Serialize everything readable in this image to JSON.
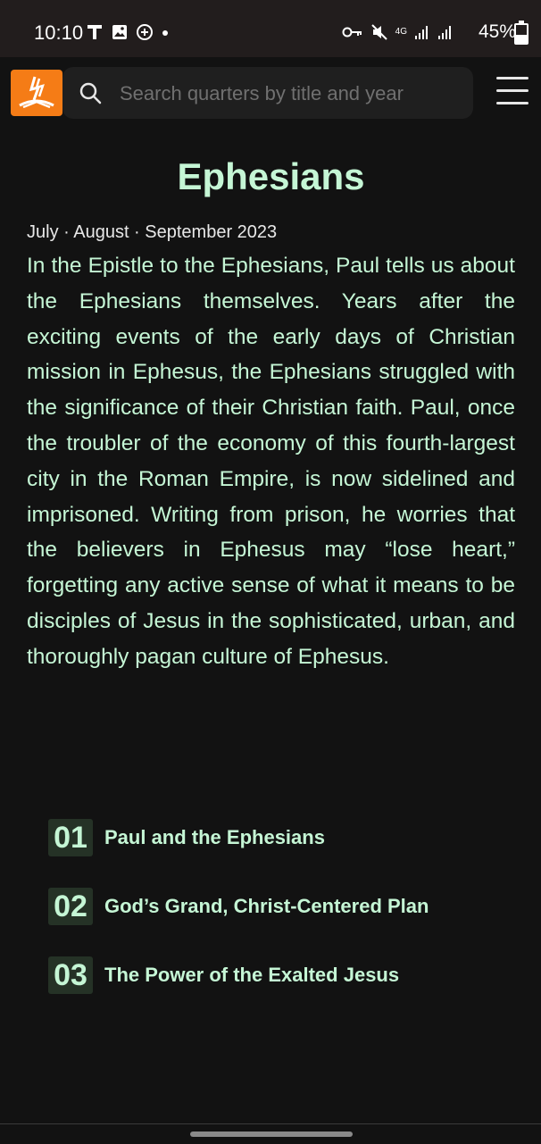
{
  "status_bar": {
    "time": "10:10",
    "network": "4G",
    "battery_percent": "45%",
    "battery_level": 0.45,
    "icons": [
      "t-mobile-icon",
      "image-icon",
      "messenger-icon",
      "dot-icon",
      "key-icon",
      "mute-icon",
      "network-arrows-icon",
      "signal-icon",
      "signal-icon",
      "battery-icon"
    ]
  },
  "app_bar": {
    "logo": "adventist-logo-icon",
    "search": {
      "placeholder": "Search quarters by title and year",
      "value": ""
    },
    "menu_icon": "hamburger-menu-icon"
  },
  "quarter": {
    "title": "Ephesians",
    "period": "July · August · September 2023",
    "description": "In the Epistle to the Ephesians, Paul tells us about the Ephesians themselves. Years after the exciting events of the early days of Christian mission in Ephesus, the Ephesians struggled with the significance of their Christian faith. Paul, once the troubler of the economy of this fourth-largest city in the Roman Empire, is now sidelined and imprisoned. Writing from prison, he worries that the believers in Ephesus may “lose heart,” forgetting any active sense of what it means to be disciples of Jesus in the sophisticated, urban, and thoroughly pagan culture of Ephesus."
  },
  "lessons": [
    {
      "number": "01",
      "title": "Paul and the Ephesians"
    },
    {
      "number": "02",
      "title": "God’s Grand, Christ-Centered Plan"
    },
    {
      "number": "03",
      "title": "The Power of the Exalted Jesus"
    }
  ],
  "colors": {
    "background": "#121212",
    "accent_text": "#c5f6d5",
    "logo": "#f57c16",
    "status_bar": "#221d1d"
  }
}
